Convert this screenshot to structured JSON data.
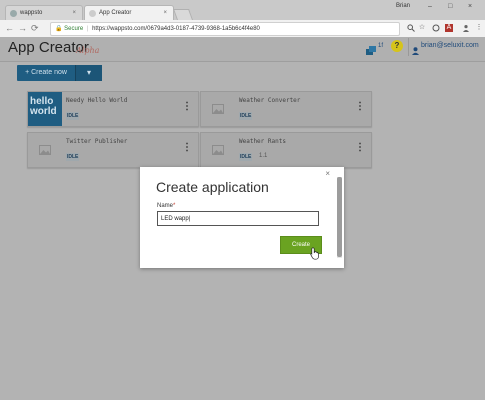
{
  "browser": {
    "tabs": [
      {
        "label": "wappsto",
        "close": "×"
      },
      {
        "label": "App Creator",
        "close": "×"
      }
    ],
    "profile_name": "Brian",
    "window_controls": {
      "minimize": "–",
      "maximize": "□",
      "close": "×"
    },
    "address": {
      "secure_label": "Secure",
      "url": "https://wappsto.com/0679a4d3-0187-4739-9368-1a5b6c4f4e80"
    },
    "nav": {
      "back": "←",
      "forward": "→",
      "reload": "⟳"
    }
  },
  "app": {
    "title": "App Creator",
    "tagline": "Alpha",
    "stack_count": "1f",
    "help_symbol": "?",
    "user_email": "brian@seluxit.com",
    "create_new_label": "+ Create now",
    "dropdown_caret": "▾"
  },
  "apps": [
    {
      "name": "Needy Hello World",
      "status": "IDLE",
      "version": "",
      "thumb_text": "hello world"
    },
    {
      "name": "Weather Converter",
      "status": "IDLE",
      "version": ""
    },
    {
      "name": "Twitter Publisher",
      "status": "IDLE",
      "version": ""
    },
    {
      "name": "Weather Rants",
      "status": "IDLE",
      "version": "1.1"
    }
  ],
  "dialog": {
    "title": "Create application",
    "close": "×",
    "field_label": "Name",
    "required_mark": "*",
    "field_value": "LED wapp",
    "create_label": "Create"
  },
  "colors": {
    "overlay": "#b3b3b3",
    "primary": "#1f5d82",
    "create_green": "#6aa321",
    "help_yellow": "#d6c41a"
  }
}
